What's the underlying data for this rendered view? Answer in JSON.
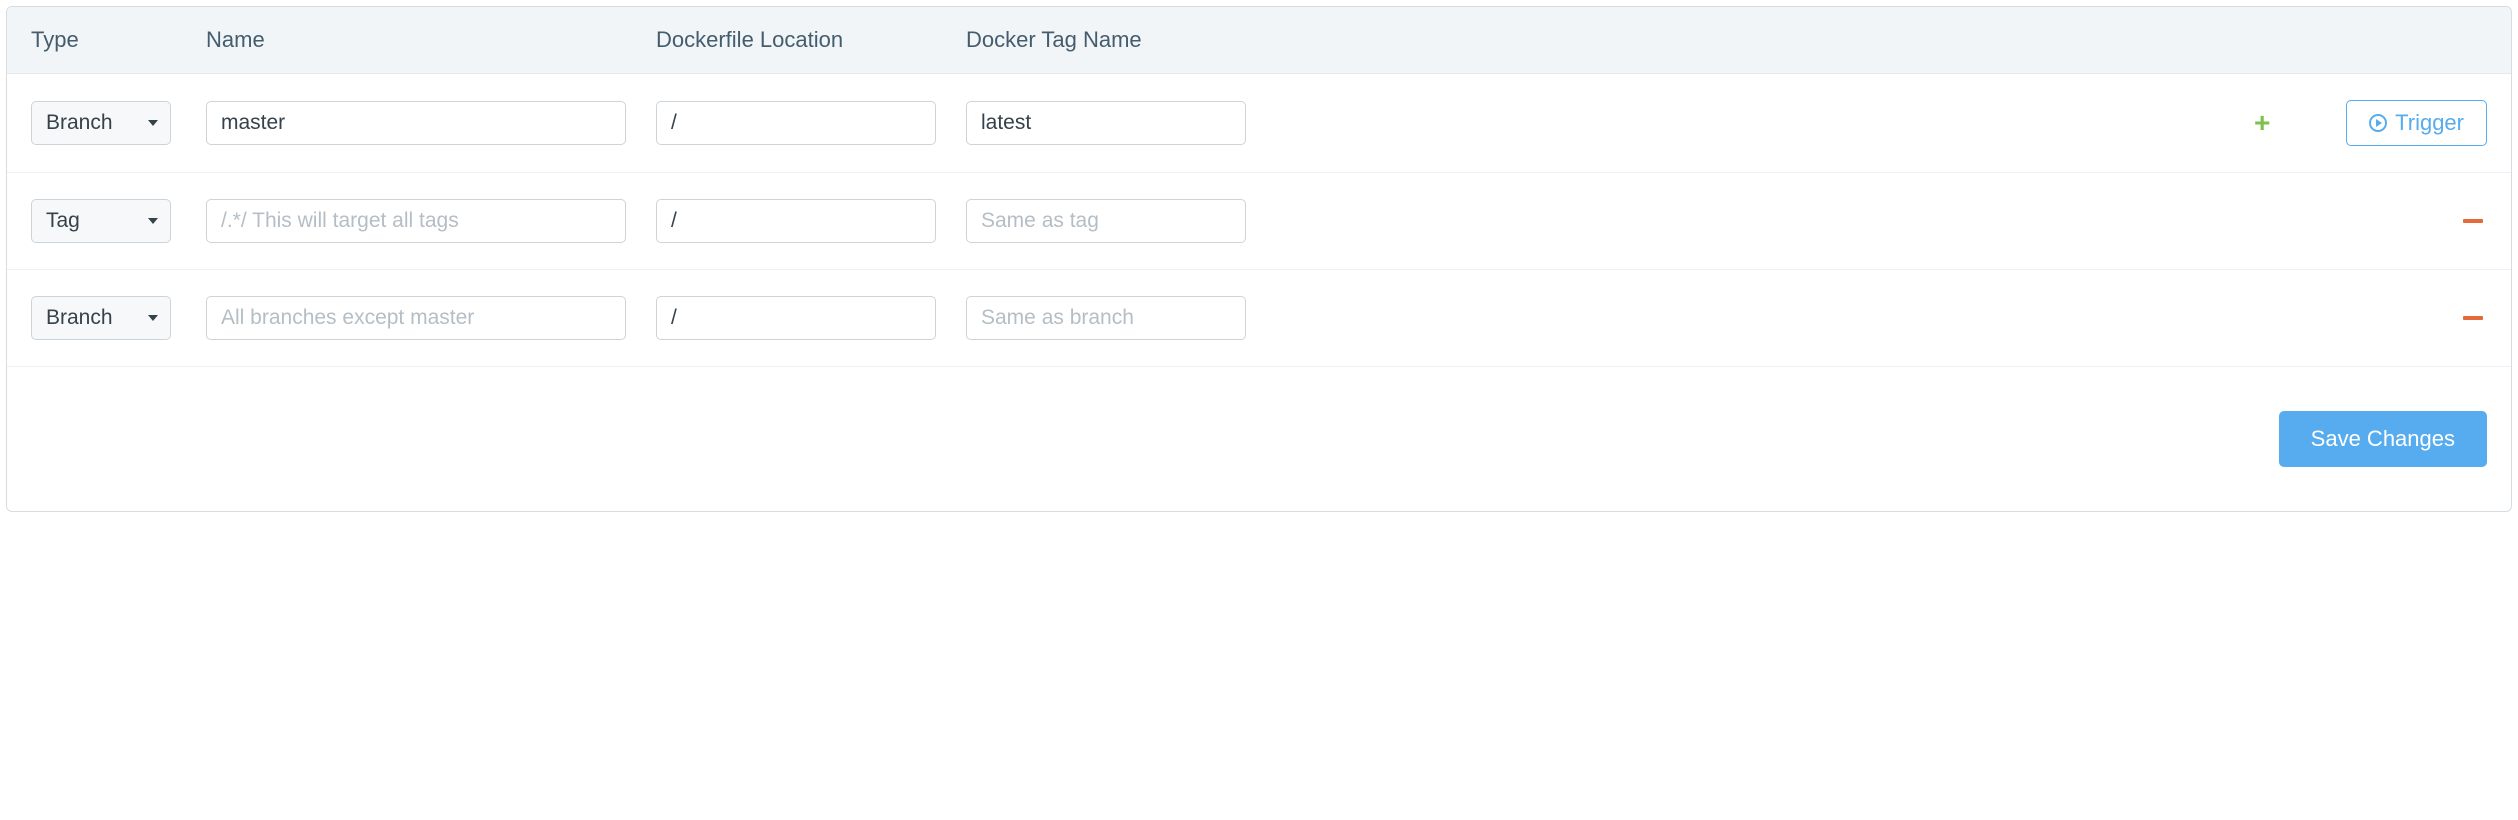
{
  "headers": {
    "type": "Type",
    "name": "Name",
    "location": "Dockerfile Location",
    "tag": "Docker Tag Name"
  },
  "rows": [
    {
      "type": "Branch",
      "name": {
        "value": "master",
        "placeholder": ""
      },
      "location": {
        "value": "/",
        "placeholder": ""
      },
      "tag": {
        "value": "latest",
        "placeholder": ""
      },
      "action": "add",
      "trigger": true
    },
    {
      "type": "Tag",
      "name": {
        "value": "",
        "placeholder": "/.*/ This will target all tags"
      },
      "location": {
        "value": "/",
        "placeholder": ""
      },
      "tag": {
        "value": "",
        "placeholder": "Same as tag"
      },
      "action": "remove",
      "trigger": false
    },
    {
      "type": "Branch",
      "name": {
        "value": "",
        "placeholder": "All branches except master"
      },
      "location": {
        "value": "/",
        "placeholder": ""
      },
      "tag": {
        "value": "",
        "placeholder": "Same as branch"
      },
      "action": "remove",
      "trigger": false
    }
  ],
  "buttons": {
    "trigger": "Trigger",
    "save": "Save Changes"
  }
}
